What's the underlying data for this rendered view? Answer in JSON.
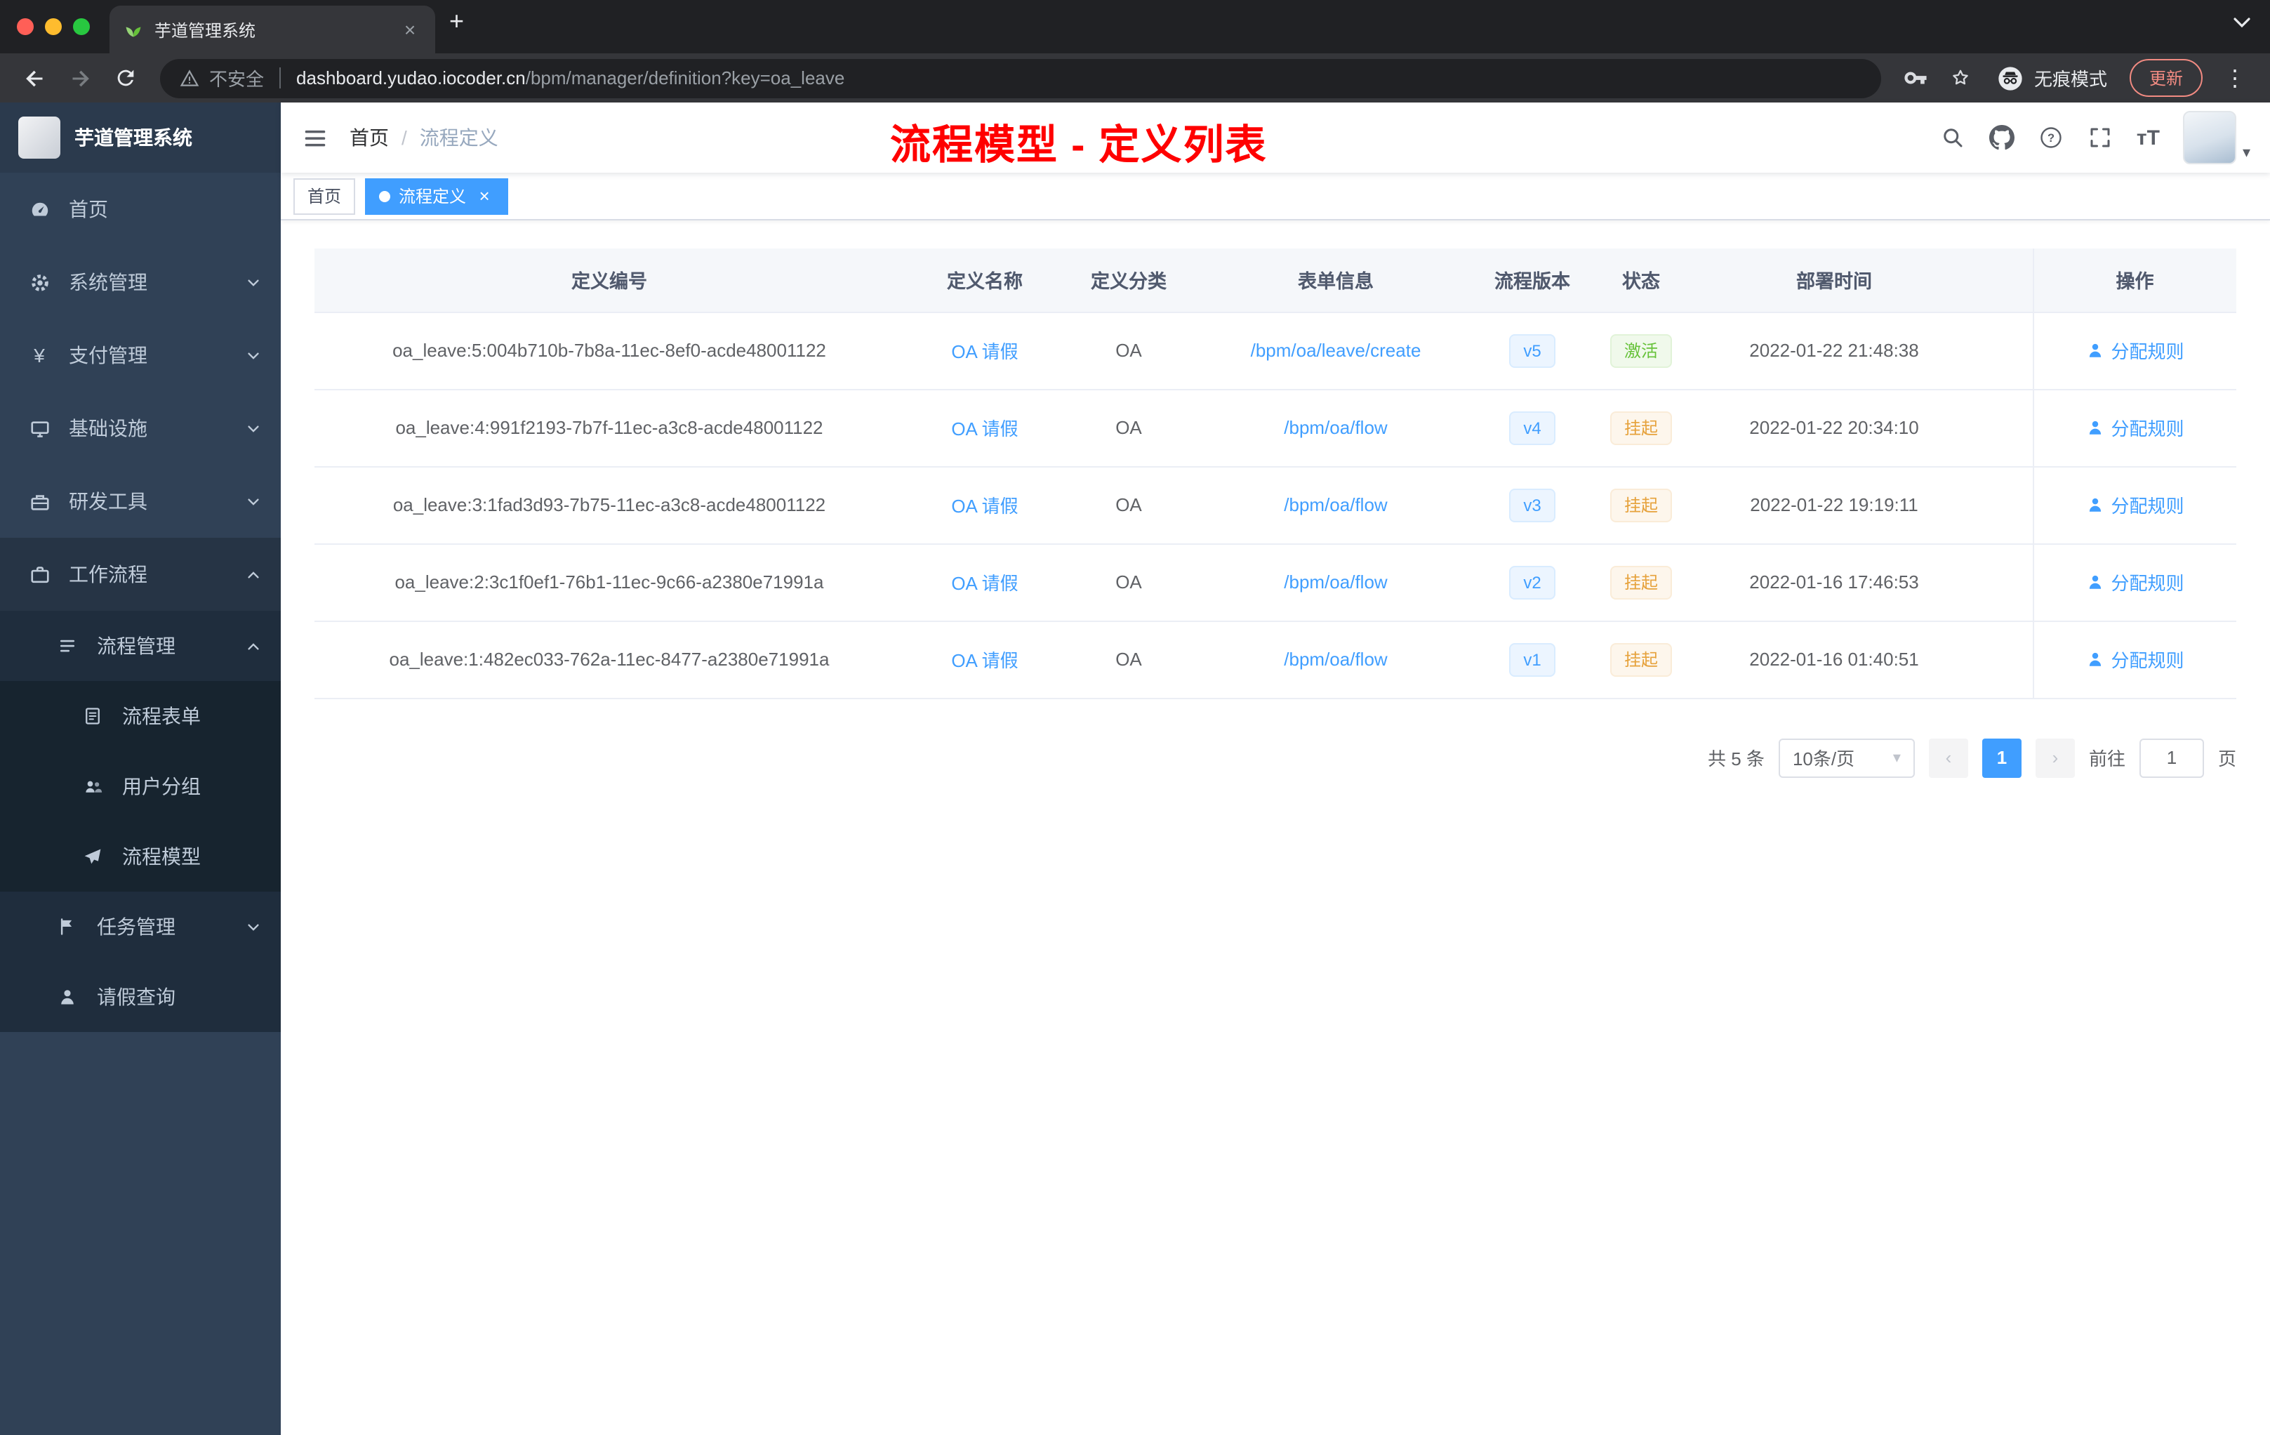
{
  "browser": {
    "tab_title": "芋道管理系统",
    "security_label": "不安全",
    "url_host": "dashboard.yudao.iocoder.cn",
    "url_path": "/bpm/manager/definition?key=oa_leave",
    "incognito_label": "无痕模式",
    "update_label": "更新"
  },
  "sidebar": {
    "logo_title": "芋道管理系统",
    "items": [
      {
        "label": "首页"
      },
      {
        "label": "系统管理"
      },
      {
        "label": "支付管理"
      },
      {
        "label": "基础设施"
      },
      {
        "label": "研发工具"
      },
      {
        "label": "工作流程"
      },
      {
        "label": "流程管理"
      },
      {
        "label": "流程表单"
      },
      {
        "label": "用户分组"
      },
      {
        "label": "流程模型"
      },
      {
        "label": "任务管理"
      },
      {
        "label": "请假查询"
      }
    ]
  },
  "navbar": {
    "breadcrumb_home": "首页",
    "breadcrumb_separator": "/",
    "breadcrumb_current": "流程定义",
    "annotation": "流程模型 - 定义列表"
  },
  "tags_view": {
    "home": "首页",
    "active": "流程定义"
  },
  "table": {
    "headers": [
      "定义编号",
      "定义名称",
      "定义分类",
      "表单信息",
      "流程版本",
      "状态",
      "部署时间",
      "操作"
    ],
    "action_label": "分配规则",
    "rows": [
      {
        "id": "oa_leave:5:004b710b-7b8a-11ec-8ef0-acde48001122",
        "name": "OA 请假",
        "category": "OA",
        "form": "/bpm/oa/leave/create",
        "version": "v5",
        "status": "激活",
        "time": "2022-01-22 21:48:38"
      },
      {
        "id": "oa_leave:4:991f2193-7b7f-11ec-a3c8-acde48001122",
        "name": "OA 请假",
        "category": "OA",
        "form": "/bpm/oa/flow",
        "version": "v4",
        "status": "挂起",
        "time": "2022-01-22 20:34:10"
      },
      {
        "id": "oa_leave:3:1fad3d93-7b75-11ec-a3c8-acde48001122",
        "name": "OA 请假",
        "category": "OA",
        "form": "/bpm/oa/flow",
        "version": "v3",
        "status": "挂起",
        "time": "2022-01-22 19:19:11"
      },
      {
        "id": "oa_leave:2:3c1f0ef1-76b1-11ec-9c66-a2380e71991a",
        "name": "OA 请假",
        "category": "OA",
        "form": "/bpm/oa/flow",
        "version": "v2",
        "status": "挂起",
        "time": "2022-01-16 17:46:53"
      },
      {
        "id": "oa_leave:1:482ec033-762a-11ec-8477-a2380e71991a",
        "name": "OA 请假",
        "category": "OA",
        "form": "/bpm/oa/flow",
        "version": "v1",
        "status": "挂起",
        "time": "2022-01-16 01:40:51"
      }
    ]
  },
  "pagination": {
    "total": "共 5 条",
    "page_size": "10条/页",
    "prev": "‹",
    "current": "1",
    "next": "›",
    "goto_label": "前往",
    "goto_value": "1",
    "page_unit": "页"
  },
  "icons": {
    "close": "×",
    "plus": "+",
    "ellipsis": "⋮",
    "caret_down": "▾",
    "yen": "¥",
    "font_size": "тT"
  },
  "colors": {
    "accent": "#409eff",
    "annotation_red": "#ff0000",
    "status_active_green": "#67c23a",
    "status_suspended_orange": "#e6a23c",
    "sidebar_bg": "#304156"
  }
}
